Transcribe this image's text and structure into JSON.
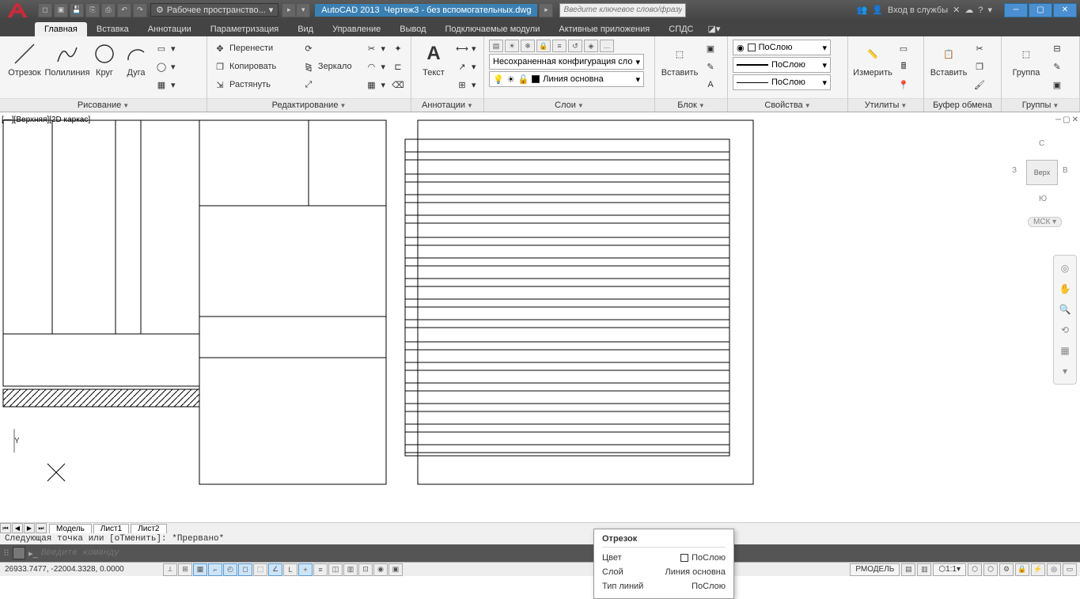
{
  "titlebar": {
    "workspace_label": "Рабочее пространство...",
    "app_name": "AutoCAD 2013",
    "doc_name": "Чертеж3 - без вспомогательных.dwg",
    "search_placeholder": "Введите ключевое слово/фразу",
    "signin_label": "Вход в службы",
    "qat_icons": [
      "new",
      "open",
      "save",
      "saveas",
      "plot",
      "undo",
      "redo"
    ]
  },
  "tabs": {
    "items": [
      "Главная",
      "Вставка",
      "Аннотации",
      "Параметризация",
      "Вид",
      "Управление",
      "Вывод",
      "Подключаемые модули",
      "Активные приложения",
      "СПДС"
    ],
    "active_index": 0
  },
  "ribbon": {
    "draw": {
      "title": "Рисование",
      "tools": {
        "line": "Отрезок",
        "polyline": "Полилиния",
        "circle": "Круг",
        "arc": "Дуга"
      }
    },
    "modify": {
      "title": "Редактирование",
      "items": {
        "move": "Перенести",
        "copy": "Копировать",
        "stretch": "Растянуть",
        "mirror": "Зеркало"
      }
    },
    "annotation": {
      "title": "Аннотации",
      "text": "Текст"
    },
    "layers": {
      "title": "Слои",
      "config": "Несохраненная конфигурация сло",
      "current": "Линия основна"
    },
    "block": {
      "title": "Блок",
      "insert": "Вставить"
    },
    "properties": {
      "title": "Свойства",
      "bycolor": "ПоСлою",
      "bylinetype": "ПоСлою",
      "bylineweight": "ПоСлою"
    },
    "utilities": {
      "title": "Утилиты",
      "measure": "Измерить"
    },
    "clipboard": {
      "title": "Буфер обмена",
      "paste": "Вставить"
    },
    "groups": {
      "title": "Группы",
      "group": "Группа"
    }
  },
  "viewport": {
    "label": "[—][Верхняя][2D каркас]"
  },
  "viewcube": {
    "face": "Верх",
    "n": "С",
    "s": "Ю",
    "e": "В",
    "w": "З",
    "ucs": "МСК"
  },
  "tooltip": {
    "title": "Отрезок",
    "rows": {
      "color_label": "Цвет",
      "color_value": "ПоСлою",
      "layer_label": "Слой",
      "layer_value": "Линия основна",
      "ltype_label": "Тип линий",
      "ltype_value": "ПоСлою"
    }
  },
  "layout_tabs": {
    "items": [
      "Модель",
      "Лист1",
      "Лист2"
    ]
  },
  "commandline": {
    "history": "Следующая точка или [оТменить]: *Прервано*",
    "placeholder": "Введите команду"
  },
  "statusbar": {
    "coords": "26933.7477, -22004.3328, 0.0000",
    "model": "РМОДЕЛЬ",
    "scale": "1:1"
  }
}
